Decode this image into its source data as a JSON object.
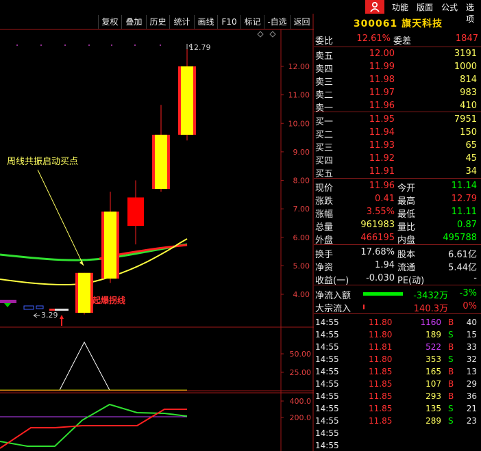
{
  "menu": {
    "items": [
      "功能",
      "版面",
      "公式",
      "选项"
    ]
  },
  "toolbar": {
    "buttons": [
      "复权",
      "叠加",
      "历史",
      "统计",
      "画线",
      "F10",
      "标记",
      "-自选",
      "返回"
    ]
  },
  "stock": {
    "code": "300061",
    "name": "旗天科技"
  },
  "main_chart": {
    "high_label": "12.79",
    "low_label": "3.29",
    "annotation": "周线共振启动买点",
    "signal_label": "起爆拐线",
    "y_ticks": [
      "12.00",
      "11.00",
      "10.00",
      "9.00",
      "8.00",
      "7.00",
      "6.00",
      "5.00",
      "4.00"
    ],
    "colors": {
      "up": "#ff2020",
      "down": "#ff0000",
      "body_fill": "#ffff00",
      "ma_fast": "#ffff40",
      "ma_mid": "#ff3030",
      "ma_slow": "#30e030"
    }
  },
  "chart_data": {
    "type": "candlestick",
    "candles": [
      {
        "open": 3.35,
        "close": 4.75,
        "high": 4.75,
        "low": 3.29
      },
      {
        "open": 4.55,
        "close": 6.9,
        "high": 7.6,
        "low": 4.4
      },
      {
        "open": 7.4,
        "close": 6.4,
        "high": 8.0,
        "low": 5.75
      },
      {
        "open": 7.7,
        "close": 9.6,
        "high": 10.65,
        "low": 7.6
      },
      {
        "open": 9.6,
        "close": 12.0,
        "high": 12.79,
        "low": 9.4
      }
    ],
    "ylim": [
      3.2,
      12.9
    ],
    "sub1_ticks": [
      "50.00",
      "25.00"
    ],
    "sub2_ticks": [
      "400.0",
      "200.0"
    ]
  },
  "quote": {
    "webi": {
      "label": "委比",
      "value": "12.61%",
      "label2": "委差",
      "value2": "1847"
    },
    "asks": [
      {
        "label": "卖五",
        "price": "12.00",
        "vol": "3191"
      },
      {
        "label": "卖四",
        "price": "11.99",
        "vol": "1000"
      },
      {
        "label": "卖三",
        "price": "11.98",
        "vol": "814"
      },
      {
        "label": "卖二",
        "price": "11.97",
        "vol": "983"
      },
      {
        "label": "卖一",
        "price": "11.96",
        "vol": "410"
      }
    ],
    "bids": [
      {
        "label": "买一",
        "price": "11.95",
        "vol": "7951"
      },
      {
        "label": "买二",
        "price": "11.94",
        "vol": "150"
      },
      {
        "label": "买三",
        "price": "11.93",
        "vol": "65"
      },
      {
        "label": "买四",
        "price": "11.92",
        "vol": "45"
      },
      {
        "label": "买五",
        "price": "11.91",
        "vol": "34"
      }
    ],
    "stats": [
      {
        "l1": "现价",
        "v1": "11.96",
        "c1": "#ff3030",
        "l2": "今开",
        "v2": "11.14",
        "c2": "#00ff00"
      },
      {
        "l1": "涨跌",
        "v1": "0.41",
        "c1": "#ff3030",
        "l2": "最高",
        "v2": "12.79",
        "c2": "#ff3030"
      },
      {
        "l1": "涨幅",
        "v1": "3.55%",
        "c1": "#ff3030",
        "l2": "最低",
        "v2": "11.11",
        "c2": "#00ff00"
      },
      {
        "l1": "总量",
        "v1": "961983",
        "c1": "#ffff60",
        "l2": "量比",
        "v2": "0.87",
        "c2": "#00ff00"
      },
      {
        "l1": "外盘",
        "v1": "466195",
        "c1": "#ff3030",
        "l2": "内盘",
        "v2": "495788",
        "c2": "#00ff00"
      }
    ],
    "fundamentals": [
      {
        "l1": "换手",
        "v1": "17.68%",
        "l2": "股本",
        "v2": "6.61亿"
      },
      {
        "l1": "净资",
        "v1": "1.94",
        "l2": "流通",
        "v2": "5.44亿"
      },
      {
        "l1": "收益(一)",
        "v1": "-0.030",
        "l2": "PE(动)",
        "v2": "-"
      }
    ],
    "flows": [
      {
        "label": "净流入额",
        "value": "-3432万",
        "pct": "-3%",
        "color": "#00ff00"
      },
      {
        "label": "大宗流入",
        "value": "140.3万",
        "pct": "0%",
        "color": "#ff3030"
      }
    ]
  },
  "ticks": [
    {
      "time": "14:55",
      "price": "11.80",
      "vol": "1160",
      "side": "B",
      "n": "40"
    },
    {
      "time": "14:55",
      "price": "11.80",
      "vol": "189",
      "side": "S",
      "n": "15"
    },
    {
      "time": "14:55",
      "price": "11.81",
      "vol": "522",
      "side": "B",
      "n": "33"
    },
    {
      "time": "14:55",
      "price": "11.80",
      "vol": "353",
      "side": "S",
      "n": "32"
    },
    {
      "time": "14:55",
      "price": "11.85",
      "vol": "165",
      "side": "B",
      "n": "13"
    },
    {
      "time": "14:55",
      "price": "11.85",
      "vol": "107",
      "side": "B",
      "n": "29"
    },
    {
      "time": "14:55",
      "price": "11.85",
      "vol": "293",
      "side": "B",
      "n": "36"
    },
    {
      "time": "14:55",
      "price": "11.85",
      "vol": "135",
      "side": "S",
      "n": "21"
    },
    {
      "time": "14:55",
      "price": "11.85",
      "vol": "289",
      "side": "S",
      "n": "23"
    },
    {
      "time": "14:55",
      "price": "",
      "vol": "",
      "side": "",
      "n": ""
    },
    {
      "time": "14:55",
      "price": "",
      "vol": "",
      "side": "",
      "n": ""
    }
  ]
}
